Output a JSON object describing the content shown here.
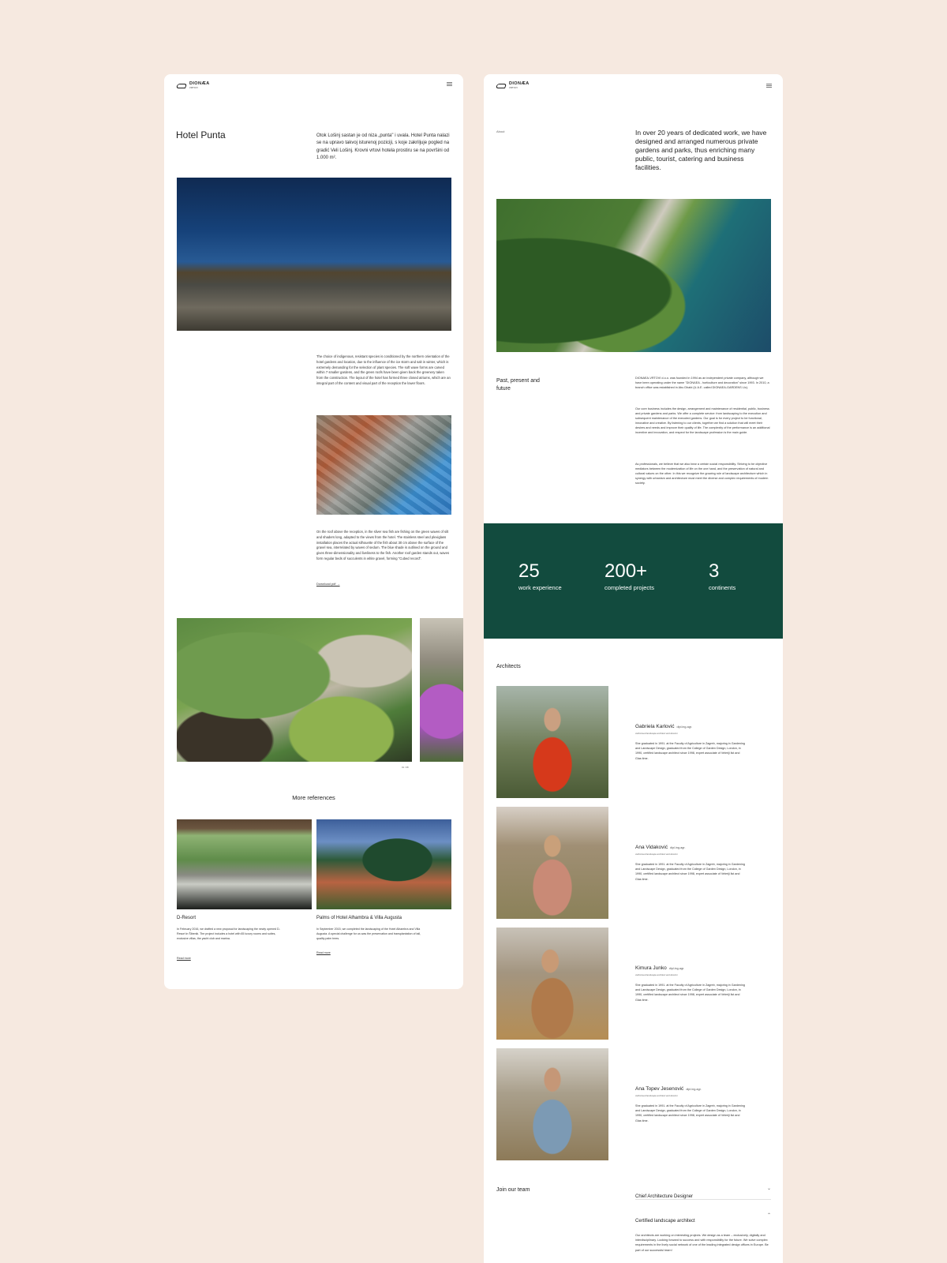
{
  "left": {
    "logo": {
      "name": "DIONÆA",
      "sub": "VRTOVI"
    },
    "title": "Hotel Punta",
    "intro": "Otok Lošinj sastan je od niza „punta\" i uvala. Hotel Punta nalazi se na upravo takvoj isturenoj poziciji, s koje zakriljuje pogled na gradić Veli Lošinj. Krovni vrtovi hotela prostiru se na površini od 1.000 m².",
    "para1": "The choice of indigenous, resistant species is conditioned by the northern orientation of the hotel gardens and location, due to the influence of the ice storm and salt in winter, which is extremely demanding for the selection of plant species. The soft wave forms are carved within 7 smaller gardens, and the green roofs have been given back the greenery taken from the construction. The layout of the hotel has formed three closed atriums, which are an integral part of the content and visual part of the reception the lower floors.",
    "para2": "On the roof above the reception, in the sliver sea fish are fishing on the green waves of silt and shaders long, adapted to the views from the hotel. The stainless steel and plexiglass installation places the actual silhouette of the fish about 30 cm above the surface of the gravel sea, interrelated by waves of sedum. The blue shade is outlined on the ground and gives three-dimensionality and liveliness to the fish. Another roof garden stands out, waves form regular beds of succulents in white gravel, forming \"Cubed record\".",
    "download": "Download pdf →",
    "gallery_counter": "01 / 08",
    "more_refs": "More references",
    "refs": [
      {
        "title": "D-Resort",
        "text": "In February 2016, we drafted a new proposal for landscaping the newly opened D-Resort in Šibenik. The project includes a hotel with 65 luxury rooms and suites, exclusive villas, the yacht club and marina.",
        "link": "Read more"
      },
      {
        "title": "Palms of Hotel Alhambra & Villa Augusta",
        "text": "In September 2015, we completed the landscaping of the Hotel Alhambra and Villa Augusta. A special challenge for us was the preservation and transplantation of tall, quality palm trees.",
        "link": "Read more"
      }
    ]
  },
  "right": {
    "logo": {
      "name": "DIONÆA",
      "sub": "VRTOVI"
    },
    "about_label": "About",
    "headline": "In over 20 years of dedicated work, we have designed and arranged numerous private gardens and parks, thus enriching many public, tourist, catering and business facilities.",
    "history_label": "Past, present and future",
    "history_p1": "DIONAEA-VRTOVI d.o.o. was founded in 1994 as an independent private company, although we have been operating under the name \"DIONAEA - horticulture and decoration\" since 1993. In 2010, a branch office was established in Abu Dhabi (U.A.E. called DIONAEA-GARDENS Llc).",
    "history_p2": "Our core business includes the design, arrangement and maintenance of residential, public, business and private gardens and parks. We offer a complete service: from landscaping to the execution and subsequent maintenance of the executed gardens. Our goal is for every project to be functional, innovative and creative. By listening to our clients, together we find a solution that will meet their desires and needs and improve their quality of life. The complexity of the performance is an additional incentive and innovation, and respect for the landscape profession is the main guide.",
    "history_p3": "As professionals, we believe that we also bear a certain social responsibility. Striving to be objective mediators between the modernization of life on the one hand, and the preservation of natural and cultural values on the other. In this we recognize the growing role of landscape architecture which in synergy with urbanism and architecture must meet the diverse and complex requirements of modern society.",
    "stats": [
      {
        "value": "25",
        "label": "work experience"
      },
      {
        "value": "200+",
        "label": "completed projects"
      },
      {
        "value": "3",
        "label": "continents"
      }
    ],
    "architects_label": "Architects",
    "architects": [
      {
        "name": "Gabriela Karlović",
        "degree": "dipl.ing.agr.",
        "role": "Authorised landscape architect and director",
        "bio": "She graduated in 1991. at the Faculty of Agriculture in Zagreb, majoring in Gardening and Landscape Design, graduated from the College of Garden Design, London, in 1990, certified landscape architect since 1998, expert associate of Veleriji list and Glas time."
      },
      {
        "name": "Ana Vidaković",
        "degree": "dipl.ing.agr.",
        "role": "Authorised landscape architect and director",
        "bio": "She graduated in 1991. at the Faculty of Agriculture in Zagreb, majoring in Gardening and Landscape Design, graduated from the College of Garden Design, London, in 1990, certified landscape architect since 1998, expert associate of Veleriji list and Glas time."
      },
      {
        "name": "Kimura Junko",
        "degree": "dipl.ing.agr.",
        "role": "Authorised landscape architect and director",
        "bio": "She graduated in 1991. at the Faculty of Agriculture in Zagreb, majoring in Gardening and Landscape Design, graduated from the College of Garden Design, London, in 1990, certified landscape architect since 1998, expert associate of Veleriji list and Glas time."
      },
      {
        "name": "Ana Topev Jesenović",
        "degree": "dipl.ing.agr.",
        "role": "Authorised landscape architect and director",
        "bio": "She graduated in 1991. at the Faculty of Agriculture in Zagreb, majoring in Gardening and Landscape Design, graduated from the College of Garden Design, London, in 1990, certified landscape architect since 1998, expert associate of Veleriji list and Glas time."
      }
    ],
    "join_label": "Join our team",
    "jobs": [
      {
        "title": "Chief Architecture Designer",
        "chevron": "⌄"
      },
      {
        "title": "Certified landscape architect",
        "chevron": "⌃",
        "text": "Our architects are working on interesting projects. We design as a team – exclusively, digitally and interdisciplinary. Looking forward to success and with responsibility for the future. We solve complex requirements in the lively social network of one of the leading integrated design offices in Europe. Be part of our successful team!"
      }
    ]
  },
  "colors": {
    "background": "#f6e9e0",
    "accent_green": "#124b3e"
  },
  "icons": {
    "menu": "hamburger-menu-icon",
    "logo": "dionaea-logo-icon"
  }
}
